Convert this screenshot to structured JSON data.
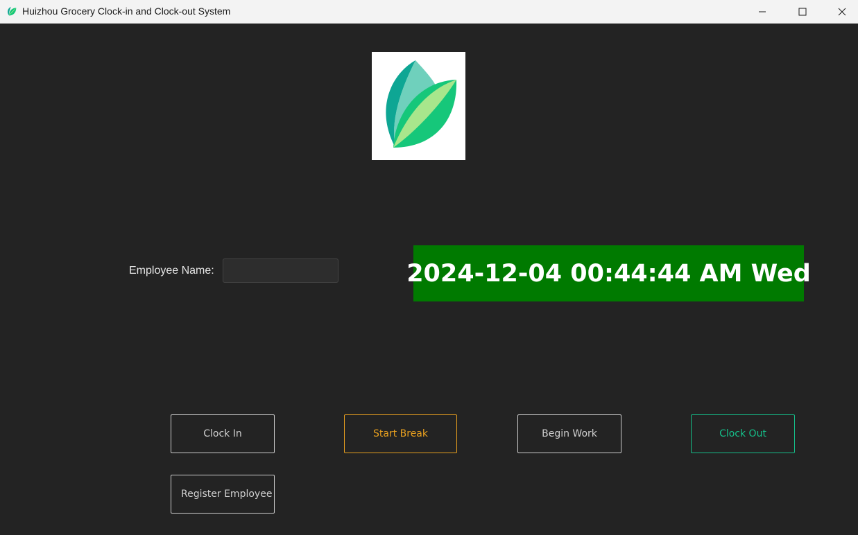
{
  "window": {
    "title": "Huizhou Grocery Clock-in and Clock-out System",
    "icon": "leaf-icon",
    "controls": [
      "minimize-icon",
      "maximize-icon",
      "close-icon"
    ]
  },
  "logo": {
    "icon": "leaf-logo",
    "colors": [
      "#0ea694",
      "#16c77a",
      "#a8e68c"
    ]
  },
  "employee": {
    "label": "Employee Name:",
    "value": "",
    "placeholder": ""
  },
  "clock": {
    "text": "2024-12-04 00:44:44 AM Wed",
    "background": "#007a00"
  },
  "buttons": {
    "clock_in": "Clock In",
    "start_break": "Start Break",
    "begin_work": "Begin Work",
    "clock_out": "Clock Out",
    "register": "Register Employee"
  },
  "colors": {
    "background": "#232323",
    "start_break_accent": "#e8a01f",
    "clock_out_accent": "#15c08a"
  }
}
